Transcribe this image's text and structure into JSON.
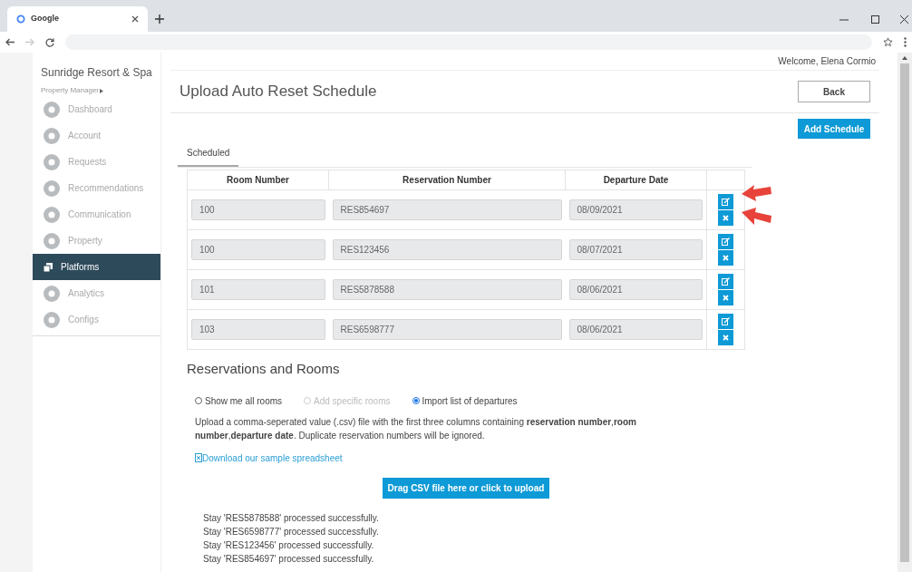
{
  "browser": {
    "tab_title": "Google"
  },
  "sidebar": {
    "property": "Sunridge Resort & Spa",
    "role": "Property Manager",
    "items": [
      {
        "label": "Dashboard",
        "selected": false
      },
      {
        "label": "Account",
        "selected": false
      },
      {
        "label": "Requests",
        "selected": false
      },
      {
        "label": "Recommendations",
        "selected": false
      },
      {
        "label": "Communication",
        "selected": false
      },
      {
        "label": "Property",
        "selected": false
      },
      {
        "label": "Platforms",
        "selected": true
      },
      {
        "label": "Analytics",
        "selected": false
      },
      {
        "label": "Configs",
        "selected": false
      }
    ]
  },
  "welcome": "Welcome, Elena Cormio",
  "page_title": "Upload Auto Reset Schedule",
  "back_button": "Back",
  "add_button": "Add Schedule",
  "tabs": [
    {
      "label": "Scheduled",
      "selected": true
    }
  ],
  "table": {
    "columns": [
      "Room Number",
      "Reservation Number",
      "Departure Date"
    ],
    "rows": [
      [
        "100",
        "RES854697",
        "08/09/2021"
      ],
      [
        "100",
        "RES123456",
        "08/07/2021"
      ],
      [
        "101",
        "RES5878588",
        "08/06/2021"
      ],
      [
        "103",
        "RES6598777",
        "08/06/2021"
      ]
    ]
  },
  "section_title": "Reservations and Rooms",
  "options": [
    {
      "label": "Show me all rooms",
      "selected": false,
      "disabled": false
    },
    {
      "label": "Add specific rooms",
      "selected": false,
      "disabled": true
    },
    {
      "label": "Import list of departures",
      "selected": true,
      "disabled": false
    }
  ],
  "instructions": "Upload a comma-seperated value (.csv) file with the first three columns containing **reservation number**,**room number**,**departure date**. Duplicate reservation numbers will be ignored.",
  "download_link": "Download our sample spreadsheet",
  "upload_button": "Drag CSV file here or click to upload",
  "messages": [
    "Stay 'RES5878588' processed successfully.",
    "Stay 'RES6598777' processed successfully.",
    "Stay 'RES123456' processed successfully.",
    "Stay 'RES854697' processed successfully."
  ]
}
